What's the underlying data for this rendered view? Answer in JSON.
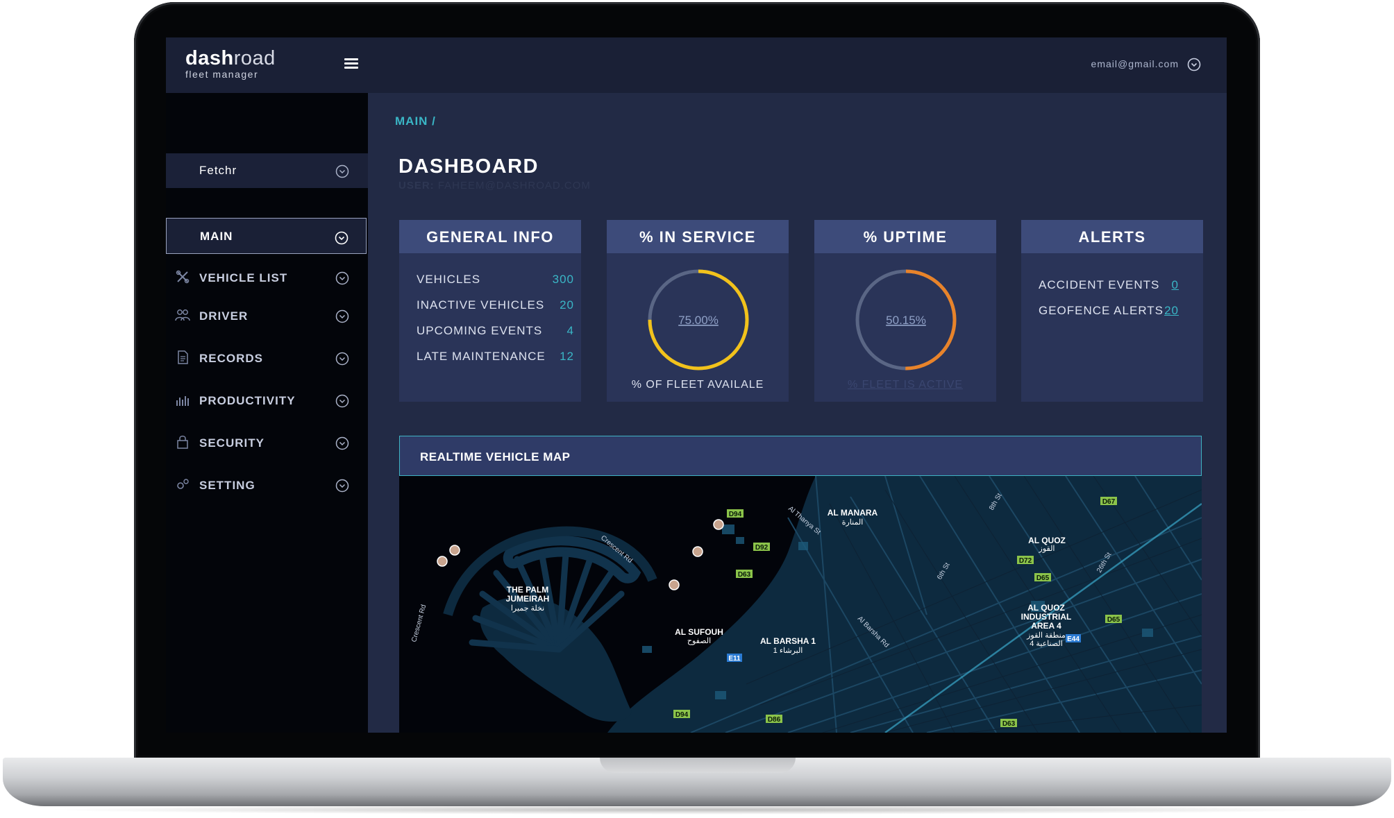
{
  "app": {
    "brand_bold": "dash",
    "brand_light": "road",
    "tagline": "fleet manager"
  },
  "header": {
    "user_email": "email@gmail.com"
  },
  "sidebar": {
    "org": "Fetchr",
    "items": [
      {
        "label": "MAIN",
        "icon": "none"
      },
      {
        "label": "VEHICLE LIST",
        "icon": "wrench-icon"
      },
      {
        "label": "DRIVER",
        "icon": "users-icon"
      },
      {
        "label": "RECORDS",
        "icon": "document-icon"
      },
      {
        "label": "PRODUCTIVITY",
        "icon": "bar-chart-icon"
      },
      {
        "label": "SECURITY",
        "icon": "lock-icon"
      },
      {
        "label": "SETTING",
        "icon": "gears-icon"
      }
    ]
  },
  "breadcrumb": "MAIN /",
  "page": {
    "title": "DASHBOARD",
    "user_label": "USER:",
    "user_value": "FAHEEM@DASHROAD.COM"
  },
  "cards": {
    "general_info": {
      "title": "GENERAL INFO",
      "rows": [
        {
          "label": "VEHICLES",
          "value": "300"
        },
        {
          "label": "INACTIVE VEHICLES",
          "value": "20"
        },
        {
          "label": "UPCOMING EVENTS",
          "value": "4"
        },
        {
          "label": "LATE MAINTENANCE",
          "value": "12"
        }
      ]
    },
    "in_service": {
      "title": "% IN SERVICE",
      "value_text": "75.00%",
      "fraction": 0.75,
      "caption": "% OF FLEET AVAILALE",
      "color": "#f2c21b"
    },
    "uptime": {
      "title": "% UPTIME",
      "value_text": "50.15%",
      "fraction": 0.5015,
      "caption": "% FLEET IS ACTIVE",
      "color": "#e8832a"
    },
    "alerts": {
      "title": "ALERTS",
      "rows": [
        {
          "label": "ACCIDENT EVENTS",
          "value": "0"
        },
        {
          "label": "GEOFENCE ALERTS",
          "value": "20"
        }
      ]
    }
  },
  "map": {
    "title": "REALTIME VEHICLE MAP",
    "labels": {
      "palm": "THE PALM",
      "palm2": "JUMEIRAH",
      "palm_ar": "نخلة جميرا",
      "crescent1": "Crescent Rd",
      "crescent2": "Crescent Rd",
      "manara": "AL MANARA",
      "manara_ar": "المنارة",
      "thanya": "Al Thanya St",
      "quoz": "AL QUOZ",
      "quoz_ar": "القوز",
      "quoz_ind1": "AL QUOZ",
      "quoz_ind2": "INDUSTRIAL",
      "quoz_ind3": "AREA 4",
      "quoz_ind_ar1": "منطقة القوز",
      "quoz_ind_ar2": "الصناعية 4",
      "sufouh": "AL SUFOUH",
      "sufouh_ar": "الصفوح",
      "barsha": "AL BARSHA 1",
      "barsha_ar": "البرشاء 1",
      "barsha_rd": "Al Barsha Rd",
      "st6": "6th St",
      "st8": "8th St",
      "st26": "26th St",
      "d94": "D94",
      "d92": "D92",
      "d63": "D63",
      "d72": "D72",
      "d65": "D65",
      "d65b": "D65",
      "d67": "D67",
      "d94b": "D94",
      "e11": "E11",
      "d86": "D86",
      "d63b": "D63",
      "e44": "E44"
    }
  }
}
